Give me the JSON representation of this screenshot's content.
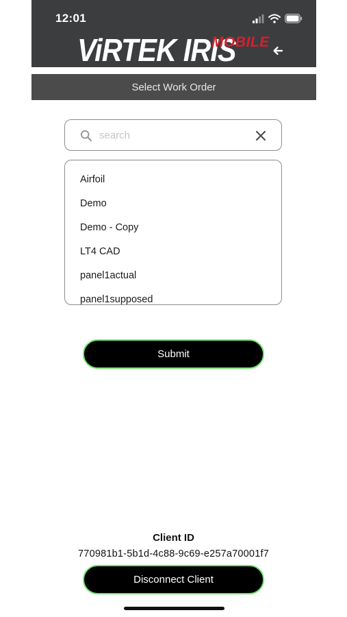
{
  "status_bar": {
    "time": "12:01",
    "icons": [
      "signal-icon",
      "wifi-icon",
      "battery-icon"
    ]
  },
  "header": {
    "logo_main": "ViRTEK IRIS",
    "logo_sub": "MOBILE",
    "back_icon": "back-arrow-icon"
  },
  "title_bar": {
    "title": "Select Work Order"
  },
  "search": {
    "placeholder": "search",
    "value": "",
    "icon": "search-icon",
    "clear_icon": "close-icon"
  },
  "work_orders": {
    "items": [
      "Airfoil",
      "Demo",
      "Demo - Copy",
      "LT4 CAD",
      "panel1actual",
      "panel1supposed"
    ]
  },
  "actions": {
    "submit_label": "Submit",
    "disconnect_label": "Disconnect Client"
  },
  "client": {
    "label": "Client ID",
    "id": "770981b1-5b1d-4c88-9c69-e257a70001f7"
  },
  "colors": {
    "header_bg": "#3c3d3f",
    "title_bar_bg": "#4b4b4b",
    "logo_accent": "#d3212c",
    "button_border": "#6fe36a",
    "button_bg": "#000000"
  }
}
